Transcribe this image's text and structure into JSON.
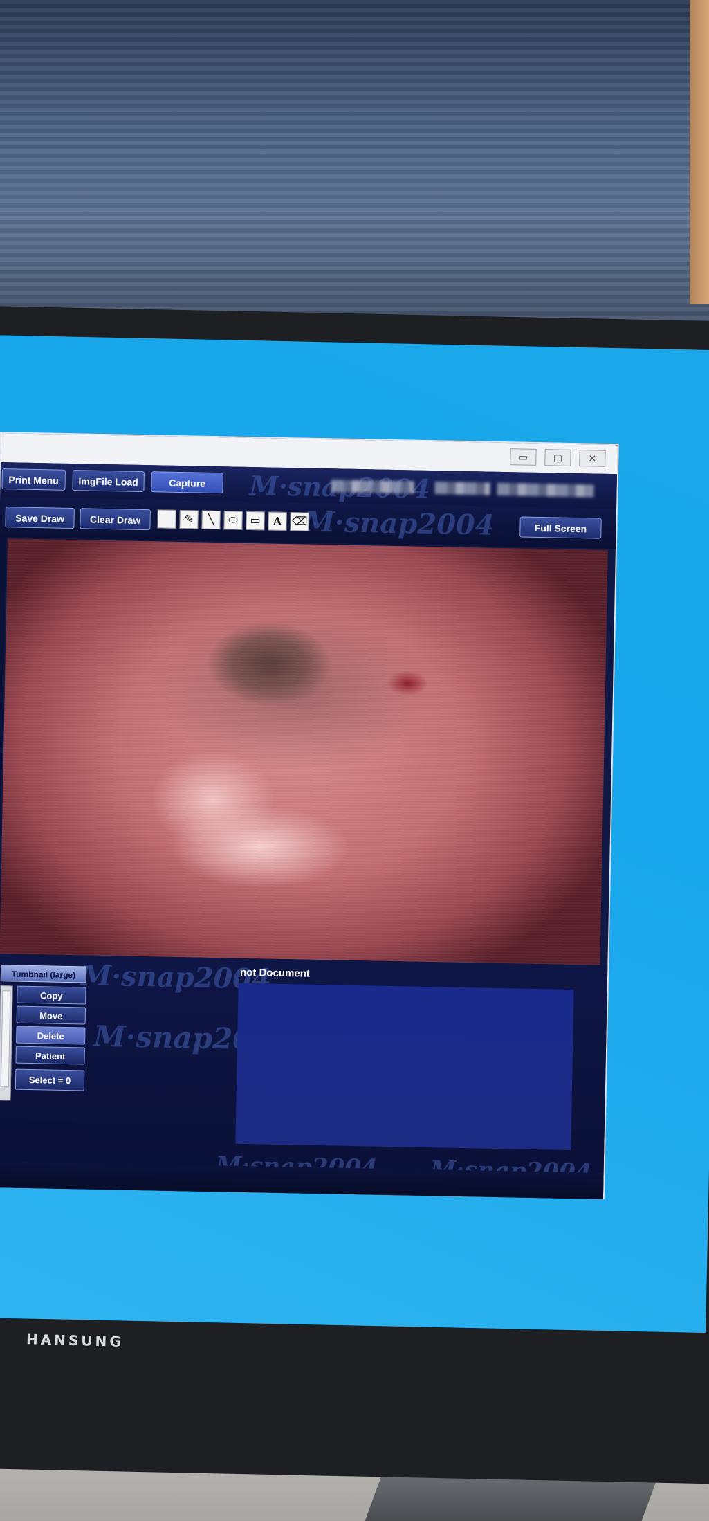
{
  "photo": {
    "monitor_brand": "HANSUNG"
  },
  "app": {
    "colors": {
      "window_bg": "#101845",
      "button_blue": "#3a4f9e",
      "doc_panel": "#1a2a8c",
      "desktop": "#18a6ec"
    },
    "watermark_text": "M·snap2004",
    "window_controls": {
      "minimize_icon": "▭",
      "maximize_icon": "▢",
      "close_icon": "✕"
    },
    "toolbar": {
      "print_menu": "Print Menu",
      "imgfile_load": "ImgFile Load",
      "capture": "Capture"
    },
    "draw_toolbar": {
      "save_draw": "Save Draw",
      "clear_draw": "Clear Draw",
      "full_screen": "Full Screen",
      "tools": [
        {
          "name": "color-swatch-icon",
          "glyph": ""
        },
        {
          "name": "pencil-icon",
          "glyph": "✎"
        },
        {
          "name": "line-icon",
          "glyph": "╲"
        },
        {
          "name": "ellipse-icon",
          "glyph": "⬭"
        },
        {
          "name": "rectangle-icon",
          "glyph": "▭"
        },
        {
          "name": "text-icon",
          "glyph": "A"
        },
        {
          "name": "eraser-icon",
          "glyph": "⌫"
        }
      ]
    },
    "thumbnail_panel": {
      "title": "Tumbnail (large)",
      "copy": "Copy",
      "move": "Move",
      "delete": "Delete",
      "patient": "Patient",
      "select": "Select = 0"
    },
    "document_panel": {
      "label": "not Document"
    }
  }
}
